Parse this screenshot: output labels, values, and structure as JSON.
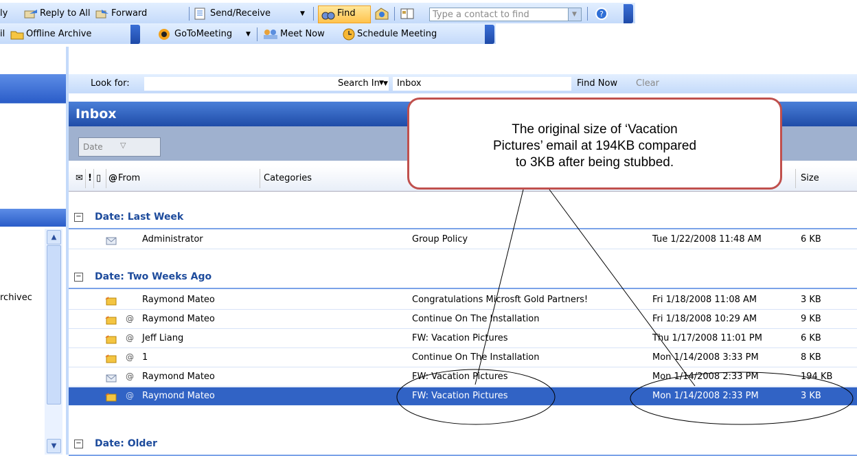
{
  "toolbar1": {
    "reply_partial": "ly",
    "reply_all": "Reply to All",
    "forward": "Forward",
    "send_receive": "Send/Receive",
    "find": "Find",
    "contact_placeholder": "Type a contact to find"
  },
  "toolbar2": {
    "mail_partial": "il",
    "offline_archive": "Offline Archive",
    "gotomeeting": "GoToMeeting",
    "meet_now": "Meet Now",
    "schedule_meeting": "Schedule Meeting"
  },
  "nav": {
    "archived_partial": "rchivec"
  },
  "findbar": {
    "look_for_label": "Look for:",
    "search_in_label": "Search In",
    "search_in_value": "Inbox",
    "find_now": "Find Now",
    "clear": "Clear"
  },
  "inbox": {
    "title": "Inbox",
    "arrange_by": "Date",
    "columns": {
      "from": "From",
      "categories": "Categories",
      "size": "Size"
    }
  },
  "groups": [
    {
      "label": "Date: Last Week",
      "rows": [
        {
          "from": "Administrator",
          "subject": "Group Policy",
          "received": "Tue 1/22/2008 11:48 AM",
          "size": "6 KB",
          "attachment": false,
          "selected": false
        }
      ]
    },
    {
      "label": "Date: Two Weeks Ago",
      "rows": [
        {
          "from": "Raymond Mateo",
          "subject": "Congratulations Microsft Gold Partners!",
          "received": "Fri 1/18/2008 11:08 AM",
          "size": "3 KB",
          "attachment": false,
          "selected": false
        },
        {
          "from": "Raymond Mateo",
          "subject": "Continue On The Installation",
          "received": "Fri 1/18/2008 10:29 AM",
          "size": "9 KB",
          "attachment": true,
          "selected": false
        },
        {
          "from": "Jeff Liang",
          "subject": "FW: Vacation Pictures",
          "received": "Thu 1/17/2008 11:01 PM",
          "size": "6 KB",
          "attachment": true,
          "selected": false
        },
        {
          "from": "1",
          "subject": "Continue On The Installation",
          "received": "Mon 1/14/2008 3:33 PM",
          "size": "8 KB",
          "attachment": true,
          "selected": false
        },
        {
          "from": "Raymond Mateo",
          "subject": "FW: Vacation Pictures",
          "received": "Mon 1/14/2008 2:33 PM",
          "size": "194 KB",
          "attachment": true,
          "selected": false
        },
        {
          "from": "Raymond Mateo",
          "subject": "FW: Vacation Pictures",
          "received": "Mon 1/14/2008 2:33 PM",
          "size": "3 KB",
          "attachment": true,
          "selected": true
        }
      ]
    },
    {
      "label": "Date: Older",
      "rows": []
    }
  ],
  "callout": {
    "line1": "The original size of ‘Vacation",
    "line2": "Pictures’ email at 194KB compared",
    "line3": "to 3KB after being stubbed."
  },
  "colors": {
    "accent": "#1f4ca8",
    "selection": "#3163c5",
    "callout_border": "#c0504d",
    "group_text": "#1d4b9c"
  }
}
